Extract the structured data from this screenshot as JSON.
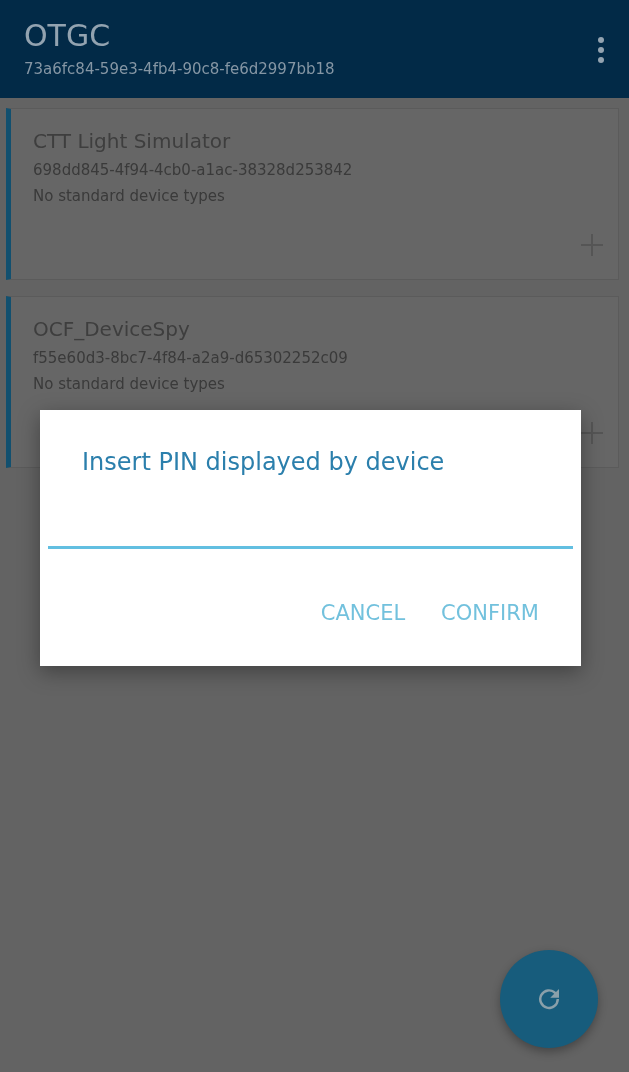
{
  "app_bar": {
    "title": "OTGC",
    "subtitle": "73a6fc84-59e3-4fb4-90c8-fe6d2997bb18"
  },
  "devices": [
    {
      "name": "CTT Light Simulator",
      "id": "698dd845-4f94-4cb0-a1ac-38328d253842",
      "types": "No standard device types"
    },
    {
      "name": "OCF_DeviceSpy",
      "id": "f55e60d3-8bc7-4f84-a2a9-d65302252c09",
      "types": "No standard device types"
    }
  ],
  "dialog": {
    "title": "Insert PIN displayed by device",
    "buttons": [
      "CANCEL",
      "CONFIRM"
    ]
  }
}
